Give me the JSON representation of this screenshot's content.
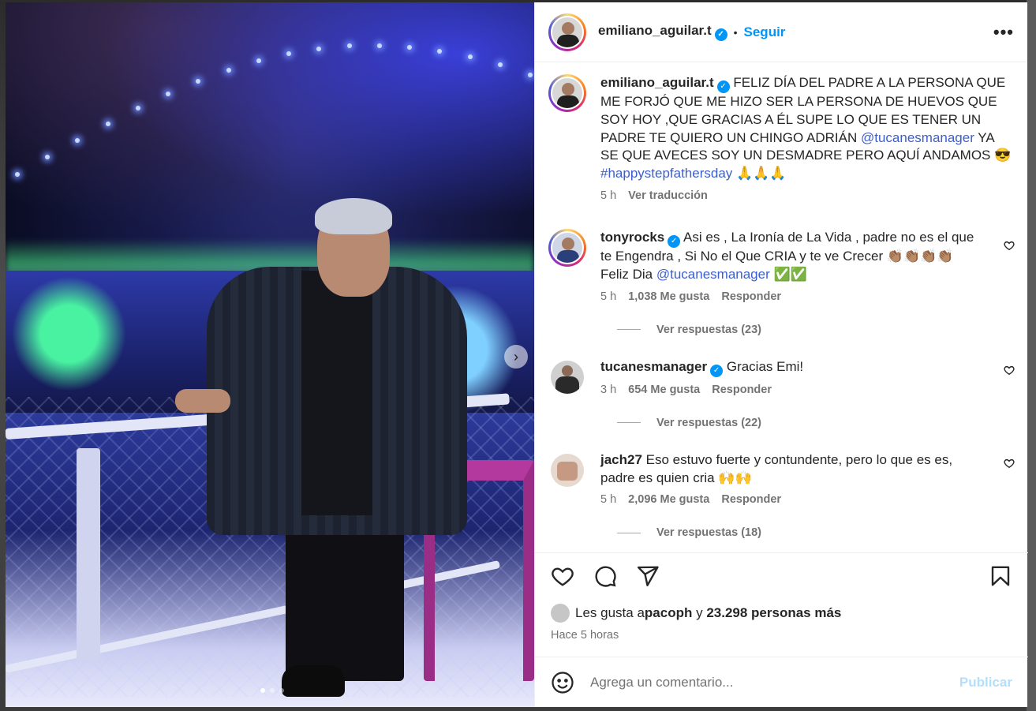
{
  "post": {
    "username": "emiliano_aguilar.t",
    "follow_label": "Seguir",
    "separator": "•",
    "more_label": "•••"
  },
  "caption": {
    "username": "emiliano_aguilar.t",
    "text_1": " FELIZ DÍA DEL PADRE A LA PERSONA QUE ME FORJÓ QUE ME HIZO SER LA PERSONA DE HUEVOS QUE SOY HOY ,QUE GRACIAS A ÉL SUPE LO QUE ES TENER UN PADRE TE QUIERO UN CHINGO ADRIÁN ",
    "mention": "@tucanesmanager",
    "text_2": " YA SE QUE AVECES SOY UN DESMADRE PERO AQUÍ ANDAMOS 😎",
    "hashtag": "#happystepfathersday",
    "text_3": " 🙏🙏🙏",
    "time": "5 h",
    "translate_label": "Ver traducción"
  },
  "comments": [
    {
      "username": "tonyrocks",
      "text_1": " Asi es , La Ironía de La Vida , padre no es el que te Engendra , Si No el Que CRIA y te ve Crecer 👏🏽👏🏽👏🏽👏🏽 Feliz Dia ",
      "mention": "@tucanesmanager",
      "text_2": " ✅✅",
      "time": "5 h",
      "likes": "1,038 Me gusta",
      "reply_label": "Responder",
      "replies_label": "Ver respuestas (23)"
    },
    {
      "username": "tucanesmanager",
      "text_1": " Gracias Emi!",
      "time": "3 h",
      "likes": "654 Me gusta",
      "reply_label": "Responder",
      "replies_label": "Ver respuestas (22)"
    },
    {
      "username": "jach27",
      "text_1": " Eso estuvo fuerte y contundente, pero lo que es es, padre es quien cria 🙌🙌",
      "time": "5 h",
      "likes": "2,096 Me gusta",
      "reply_label": "Responder",
      "replies_label": "Ver respuestas (18)"
    }
  ],
  "likes_summary": {
    "prefix": "Les gusta a ",
    "user": "pacoph",
    "middle": " y ",
    "others": "23.298 personas más"
  },
  "posted_time": "Hace 5 horas",
  "add_comment": {
    "placeholder": "Agrega un comentario...",
    "publish_label": "Publicar"
  },
  "carousel": {
    "total": 3,
    "active_index": 0,
    "next_label": "›"
  },
  "colors": {
    "link": "#3b5fcf",
    "follow": "#0095f6",
    "publish_disabled": "#b2dffc",
    "verified": "#0095f6"
  },
  "icons": [
    "heart-icon",
    "comment-icon",
    "share-icon",
    "bookmark-icon",
    "emoji-icon",
    "verified-badge-icon",
    "chevron-right-icon"
  ]
}
